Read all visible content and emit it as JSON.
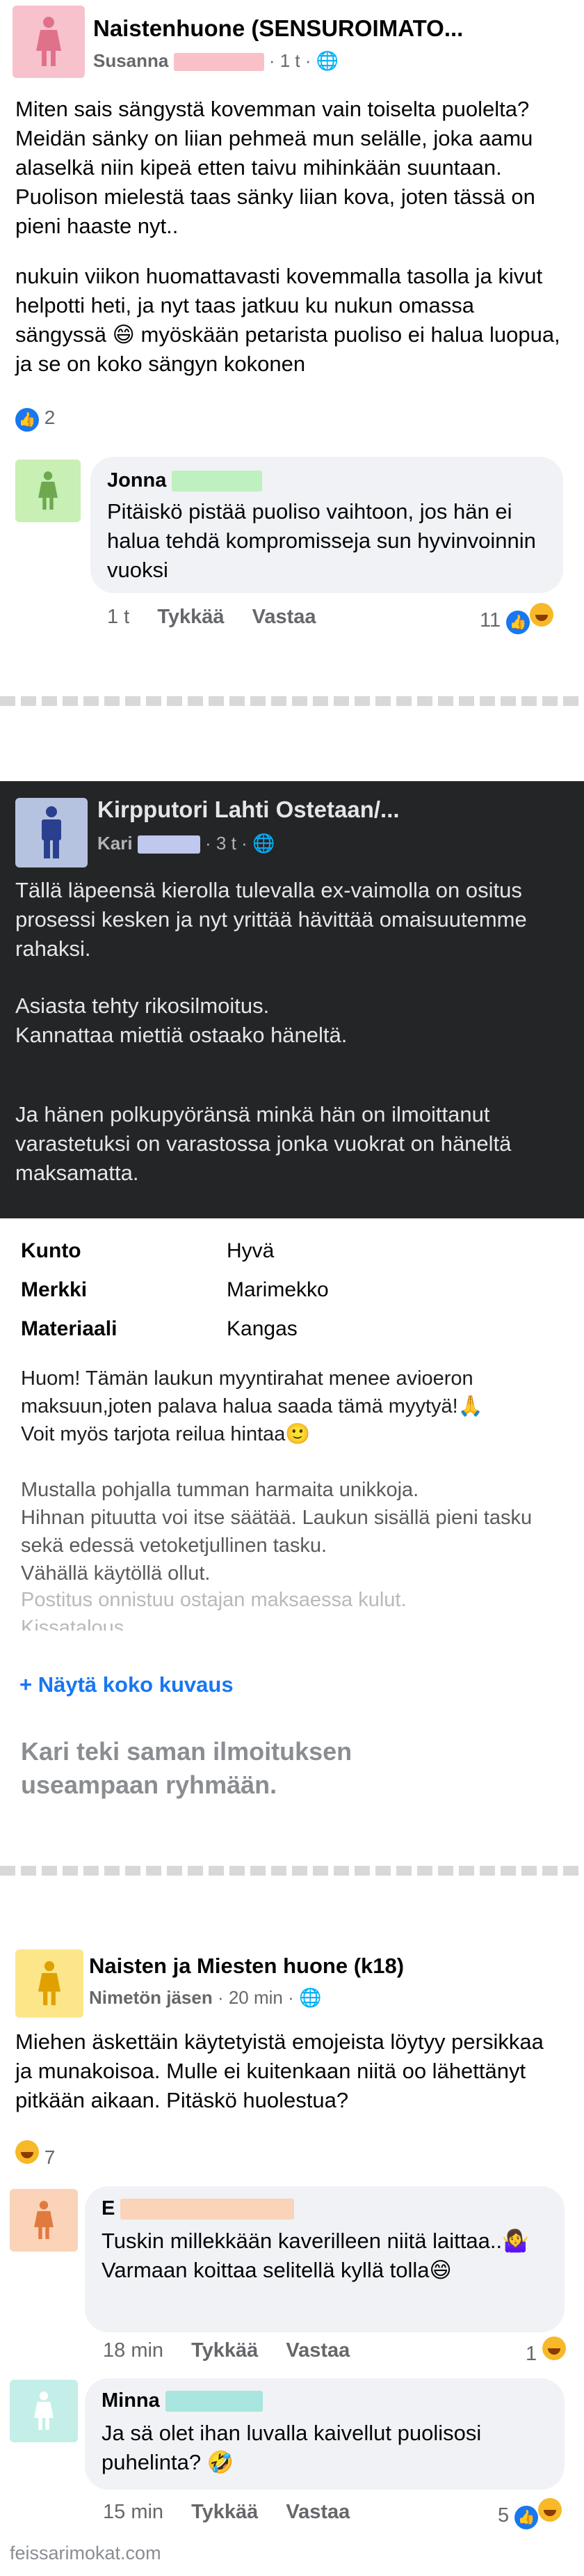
{
  "post1": {
    "group": "Naistenhuone (SENSUROIMATO...",
    "author": "Susanna",
    "time": "1 t",
    "paragraph1": "Miten sais sängystä kovemman vain toiselta puolelta? Meidän sänky on liian pehmeä mun selälle, joka aamu alaselkä niin kipeä etten taivu mihinkään suuntaan. Puolison mielestä taas sänky liian kova, joten tässä on pieni haaste nyt..",
    "paragraph2": "nukuin viikon huomattavasti kovemmalla tasolla ja kivut helpotti heti, ja nyt taas jatkuu ku nukun omassa sängyssä 😄 myöskään petarista puoliso ei halua luopua, ja se on koko sängyn kokonen",
    "reactions": "2",
    "comment": {
      "name": "Jonna",
      "text": "Pitäiskö pistää puoliso vaihtoon, jos hän ei halua tehdä kompromisseja sun hyvinvoinnin vuoksi",
      "time": "1 t",
      "like": "Tykkää",
      "reply": "Vastaa",
      "reactions": "11"
    }
  },
  "post2": {
    "group": "Kirpputori Lahti Ostetaan/...",
    "author": "Kari",
    "time": "3 t",
    "paragraph1": "Tällä läpeensä kierolla tulevalla ex-vaimolla on ositus prosessi kesken ja nyt yrittää hävittää omaisuutemme rahaksi.",
    "paragraph2": "Asiasta tehty rikosilmoitus.\nKannattaa miettiä ostaako häneltä.",
    "paragraph3": "Ja hänen polkupyöränsä minkä hän on ilmoittanut varastetuksi on varastossa jonka vuokrat on häneltä maksamatta.",
    "specs": [
      {
        "label": "Kunto",
        "value": "Hyvä"
      },
      {
        "label": "Merkki",
        "value": "Marimekko"
      },
      {
        "label": "Materiaali",
        "value": "Kangas"
      }
    ],
    "description1": "Huom! Tämän laukun myyntirahat menee avioeron maksuun,joten palava halua saada tämä myytyä!🙏\nVoit myös tarjota reilua hintaa🙂",
    "description2": "Mustalla pohjalla tumman harmaita unikkoja.\nHihnan pituutta voi itse säätää. Laukun sisällä pieni tasku sekä edessä vetoketjullinen tasku.\nVähällä käytöllä ollut.",
    "description3": "Postitus onnistuu ostajan maksaessa kulut.\nKissatalous.",
    "show_more": "+ Näytä koko kuvaus",
    "shared_note": "Kari teki saman ilmoituksen useampaan ryhmään."
  },
  "post3": {
    "group": "Naisten ja Miesten huone (k18)",
    "author": "Nimetön jäsen",
    "time": "20 min",
    "paragraph1": "Miehen äskettäin käytetyistä emojeista löytyy persikkaa ja munakoisoa. Mulle ei kuitenkaan niitä oo lähettänyt pitkään aikaan. Pitäskö huolestua?",
    "reactions": "7",
    "comments": [
      {
        "name": "E",
        "text": "Tuskin millekkään kaverilleen niitä laittaa..🤷‍♀️ Varmaan koittaa selitellä kyllä tolla😄",
        "time": "18 min",
        "like": "Tykkää",
        "reply": "Vastaa",
        "reactions": "1"
      },
      {
        "name": "Minna",
        "text": "Ja sä olet ihan luvalla kaivellut puolisosi puhelinta? 🤣",
        "time": "15 min",
        "like": "Tykkää",
        "reply": "Vastaa",
        "reactions": "5"
      }
    ]
  },
  "watermark": "feissarimokat.com",
  "colors": {
    "pink_avatar": "#f7c2cc",
    "navy_avatar": "#b6c3e0",
    "yellow_avatar": "#fde68a",
    "green_redact": "#bff0bf",
    "pink_redact": "#f9c0c8",
    "blue_redact": "#c0c8ee",
    "dark_bg": "#242526"
  }
}
